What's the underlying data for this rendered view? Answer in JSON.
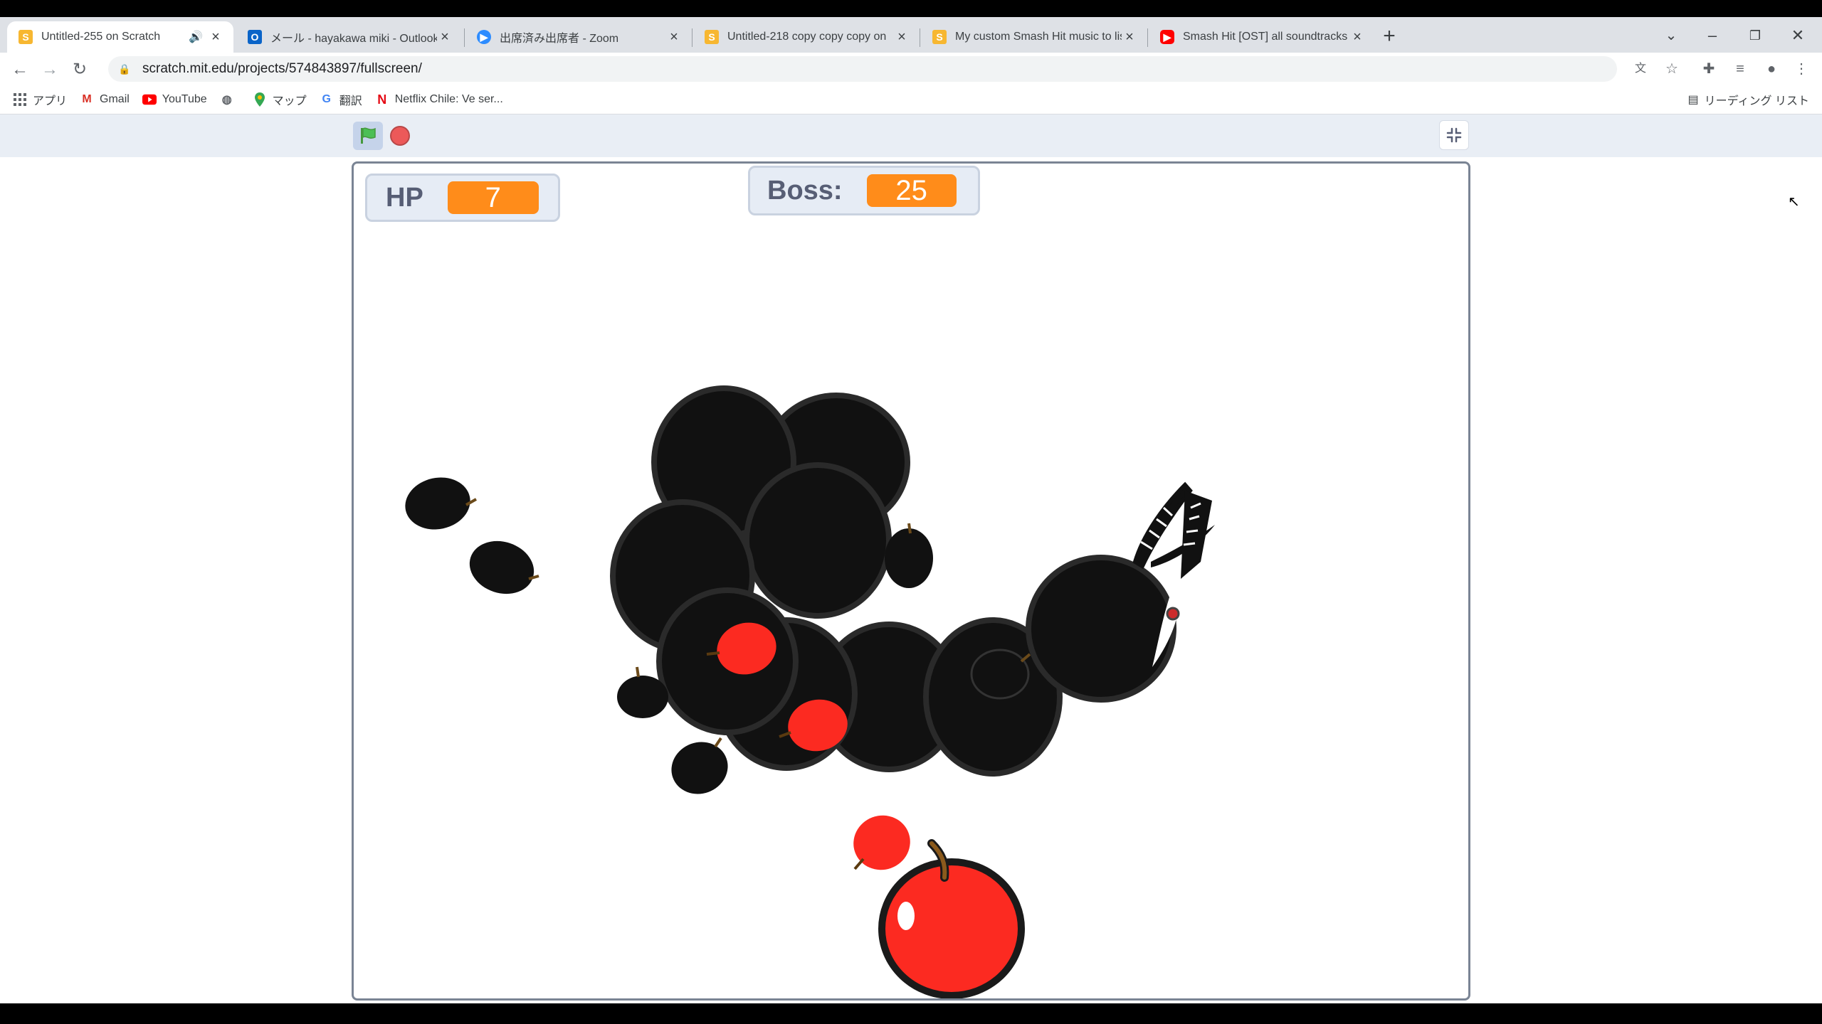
{
  "tabs": [
    {
      "title": "Untitled-255 on Scratch",
      "active": true,
      "audio": true,
      "icon": "scratch-icon"
    },
    {
      "title": "メール - hayakawa miki - Outlook",
      "icon": "outlook-icon"
    },
    {
      "title": "出席済み出席者 - Zoom",
      "icon": "zoom-icon"
    },
    {
      "title": "Untitled-218 copy copy copy on",
      "icon": "scratch-icon"
    },
    {
      "title": "My custom Smash Hit music to lis",
      "icon": "scratch-icon"
    },
    {
      "title": "Smash Hit [OST] all soundtracks",
      "icon": "youtube-icon"
    }
  ],
  "address_bar": {
    "url": "scratch.mit.edu/projects/574843897/fullscreen/"
  },
  "bookmarks": [
    {
      "label": "アプリ",
      "icon": "apps-grid-icon"
    },
    {
      "label": "Gmail",
      "icon": "gmail-icon"
    },
    {
      "label": "YouTube",
      "icon": "youtube-icon"
    },
    {
      "label": "",
      "icon": "globe-icon"
    },
    {
      "label": "マップ",
      "icon": "maps-pin-icon"
    },
    {
      "label": "翻訳",
      "icon": "translate-icon"
    },
    {
      "label": "Netflix Chile: Ve ser...",
      "icon": "netflix-icon"
    }
  ],
  "reading_list": {
    "label": "リーディング リスト"
  },
  "stage": {
    "hp_monitor": {
      "label": "HP",
      "value": "7"
    },
    "boss_monitor": {
      "label": "Boss:",
      "value": "25"
    }
  },
  "colors": {
    "monitor_value": "#ff8c1a",
    "stage_border": "#7a8494",
    "apple_red": "#fc2a21"
  }
}
